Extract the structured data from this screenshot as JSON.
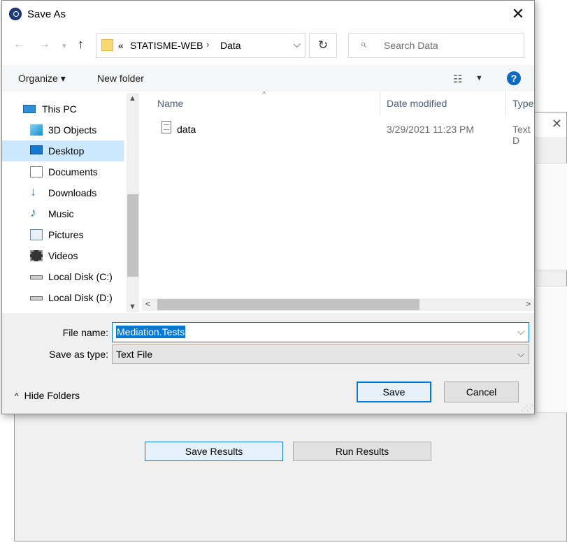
{
  "background_window": {
    "save_results_label": "Save Results",
    "run_results_label": "Run Results"
  },
  "dialog": {
    "title": "Save As",
    "close_glyph": "✕"
  },
  "address_bar": {
    "overflow": "«",
    "crumbs": [
      "STATISME-WEB",
      "Data"
    ],
    "separator": "›"
  },
  "search": {
    "placeholder": "Search Data"
  },
  "toolbar": {
    "organize_label": "Organize ▾",
    "new_folder_label": "New folder"
  },
  "nav_pane": {
    "items": [
      {
        "label": "This PC",
        "icon": "computer-icon"
      },
      {
        "label": "3D Objects",
        "icon": "3d-objects-icon"
      },
      {
        "label": "Desktop",
        "icon": "desktop-icon",
        "selected": true
      },
      {
        "label": "Documents",
        "icon": "documents-icon"
      },
      {
        "label": "Downloads",
        "icon": "downloads-icon"
      },
      {
        "label": "Music",
        "icon": "music-icon"
      },
      {
        "label": "Pictures",
        "icon": "pictures-icon"
      },
      {
        "label": "Videos",
        "icon": "videos-icon"
      },
      {
        "label": "Local Disk (C:)",
        "icon": "drive-icon"
      },
      {
        "label": "Local Disk (D:)",
        "icon": "drive-icon"
      }
    ]
  },
  "file_list": {
    "columns": [
      "Name",
      "Date modified",
      "Type"
    ],
    "rows": [
      {
        "name": "data",
        "date_modified": "3/29/2021 11:23 PM",
        "type": "Text D"
      }
    ]
  },
  "form": {
    "file_name_label": "File name:",
    "file_name_value": "Mediation.Tests",
    "save_type_label": "Save as type:",
    "save_type_value": "Text File"
  },
  "footer": {
    "hide_folders_label": "Hide Folders",
    "save_label": "Save",
    "cancel_label": "Cancel"
  },
  "colors": {
    "accent": "#0078d7",
    "selection": "#cce8ff",
    "help": "#0a6ac0"
  }
}
